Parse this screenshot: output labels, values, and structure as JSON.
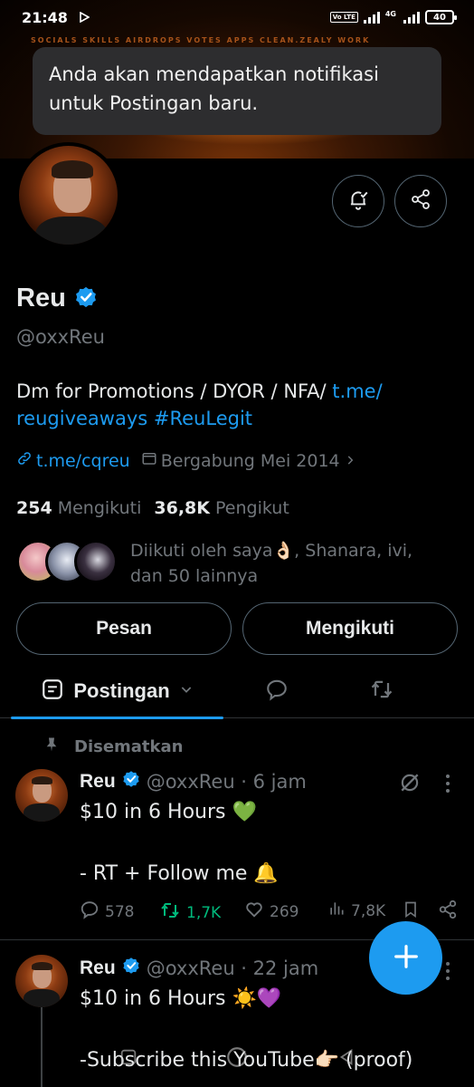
{
  "status_bar": {
    "time": "21:48",
    "network": "4G",
    "volte": "Vo LTE",
    "battery": "40"
  },
  "banner": {
    "strip_text": "SOCIALS SKILLS AIRDROPS VOTES APPS CLEAN.ZEALY WORK"
  },
  "toast": {
    "message": "Anda akan mendapatkan notifikasi untuk Postingan baru."
  },
  "profile": {
    "name": "Reu",
    "handle": "@oxxReu",
    "bio_text": "Dm for Promotions / DYOR / NFA/ ",
    "bio_link_1": "t.me/",
    "bio_link_2": "reugiveaways",
    "bio_hashtag": "#ReuLegit",
    "website": "t.me/cqreu",
    "joined": "Bergabung Mei 2014",
    "following_count": "254",
    "following_label": "Mengikuti",
    "followers_count": "36,8K",
    "followers_label": "Pengikut",
    "followed_by": "Diikuti oleh saya👌🏻, Shanara, ivi, dan 50 lainnya",
    "accent_color": "#1d9bf0"
  },
  "buttons": {
    "message": "Pesan",
    "following": "Mengikuti"
  },
  "tabs": {
    "posts": "Postingan"
  },
  "posts": [
    {
      "pinned_label": "Disematkan",
      "name": "Reu",
      "handle_time": "@oxxReu · 6 jam",
      "text": "$10 in 6 Hours 💚\n\n- RT + Follow me 🔔",
      "replies": "578",
      "reposts": "1,7K",
      "likes": "269",
      "views": "7,8K"
    },
    {
      "name": "Reu",
      "handle_time": "@oxxReu · 22 jam",
      "text": "$10 in 6 Hours ☀️💜\n\n-Subscribe this YouTube👉🏻 (proof)"
    }
  ]
}
